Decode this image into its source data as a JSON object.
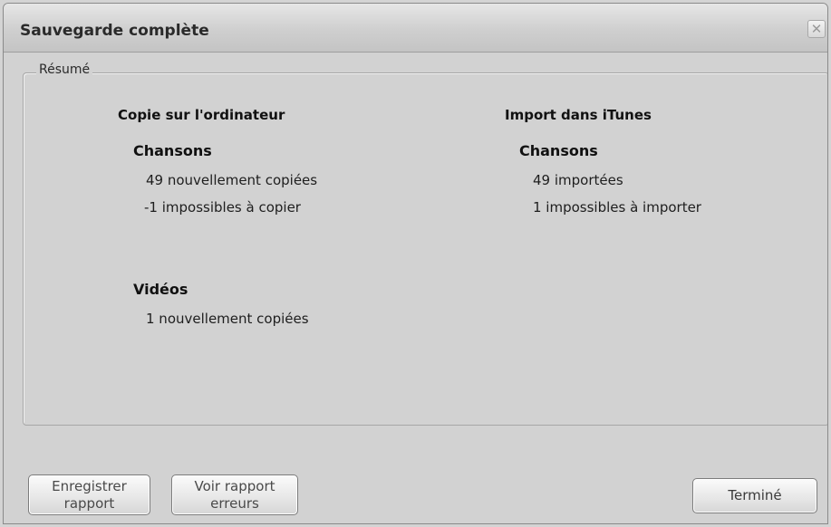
{
  "window": {
    "title": "Sauvegarde complète",
    "close_glyph": "✕"
  },
  "summary": {
    "legend": "Résumé",
    "copy_column": {
      "heading": "Copie sur l'ordinateur",
      "songs": {
        "heading": "Chansons",
        "copied": "49 nouvellement copiées",
        "failed": "-1 impossibles à copier"
      },
      "videos": {
        "heading": "Vidéos",
        "copied": "1 nouvellement copiées"
      }
    },
    "import_column": {
      "heading": "Import dans iTunes",
      "songs": {
        "heading": "Chansons",
        "imported": "49 importées",
        "failed": "1 impossibles à importer"
      }
    }
  },
  "buttons": {
    "save_report": [
      "Enregistrer",
      "rapport"
    ],
    "view_errors": [
      "Voir rapport",
      "erreurs"
    ],
    "done": "Terminé"
  },
  "icons": {
    "close": "close-icon"
  }
}
